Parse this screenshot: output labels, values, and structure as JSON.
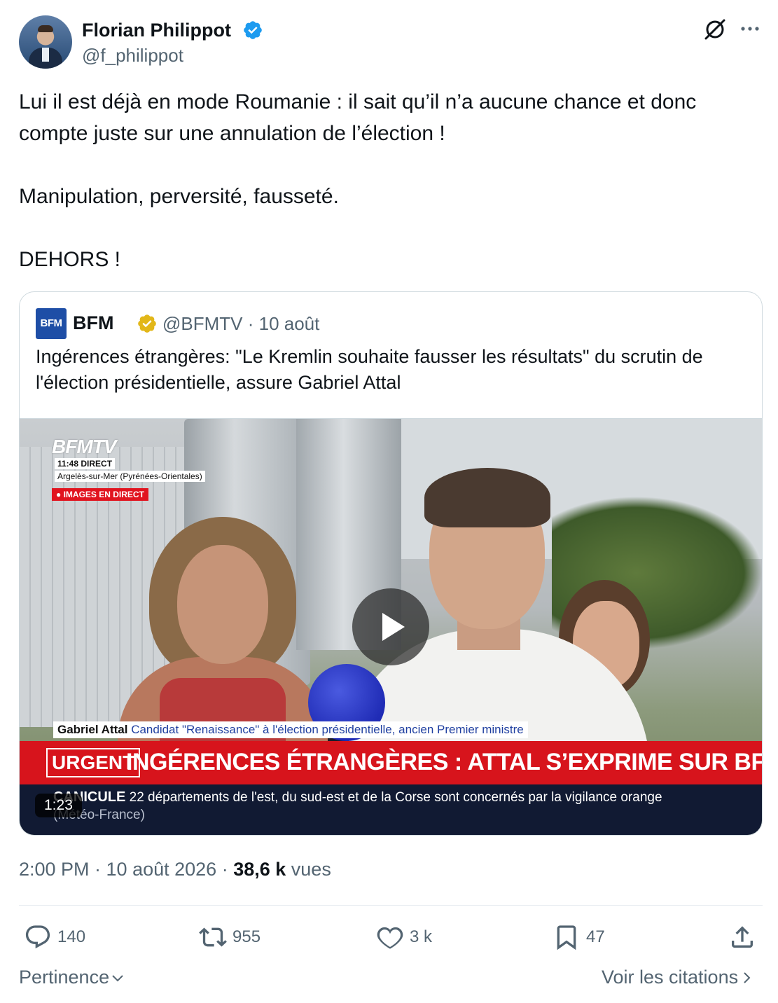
{
  "author": {
    "name": "Florian Philippot",
    "handle": "@f_philippot"
  },
  "tweet": {
    "lines": [
      "Lui il est déjà en mode Roumanie : il sait qu’il n’a aucune chance et donc compte juste sur une annulation de l’élection !",
      "Manipulation, perversité, fausseté.",
      "DEHORS !"
    ]
  },
  "quote": {
    "avatar_text": "BFM",
    "name": "BFM",
    "meta": "@BFMTV · 10 août",
    "text": "Ingérences étrangères: \"Le Kremlin souhaite fausser les résultats\" du scrutin de l'élection présidentielle, assure Gabriel Attal",
    "video": {
      "logo": "BFMTV",
      "live_time": "11:48  DIRECT",
      "location": "Argelès-sur-Mer (Pyrénées-Orientales)",
      "live_badge": "● IMAGES EN DIRECT",
      "speaker_name": "Gabriel Attal",
      "speaker_role": "Candidat \"Renaissance\" à l'élection présidentielle, ancien Premier ministre",
      "urgent_tag": "URGENT",
      "headline": "INGÉRENCES ÉTRANGÈRES : ATTAL S’EXPRIME SUR BFMTV",
      "ticker_label": "CANICULE",
      "ticker_text": " 22 départements de l'est, du sud-est et de la Corse sont concernés par la vigilance orange ",
      "ticker_source": "(Météo-France)",
      "duration": "1:23"
    }
  },
  "timestamp": {
    "time": "2:00 PM · 10 août 2026 · ",
    "views_count": "38,6 k",
    "views_label": " vues"
  },
  "actions": {
    "replies": "140",
    "reposts": "955",
    "likes": "3 k",
    "bookmarks": "47"
  },
  "footer": {
    "sort_label": "Pertinence",
    "quotes_link": "Voir les citations"
  },
  "colors": {
    "text_primary": "#0f1419",
    "text_secondary": "#536471",
    "verified_blue": "#1d9bf0",
    "verified_gold": "#e2b719",
    "bfm_red": "#d7141c"
  }
}
